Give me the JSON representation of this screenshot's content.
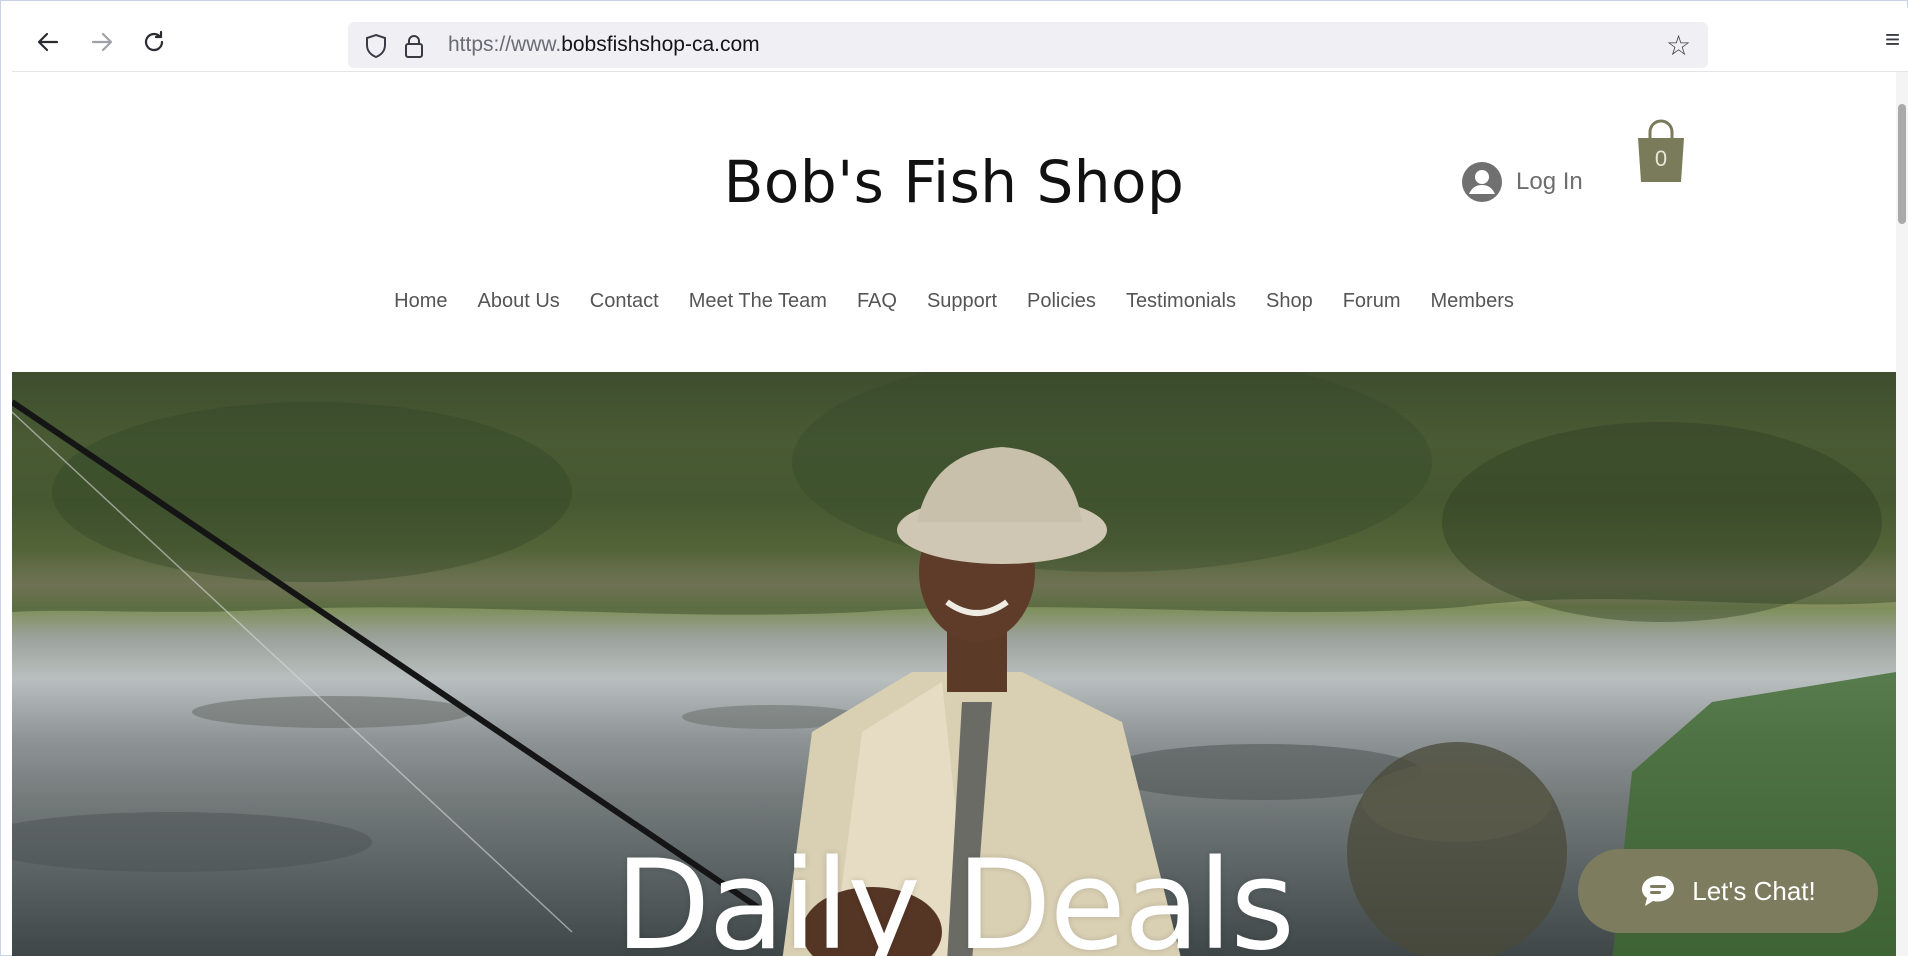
{
  "browser": {
    "url_prefix": "https://www.",
    "url_host": "bobsfishshop-ca.com"
  },
  "site": {
    "title": "Bob's Fish Shop",
    "login_label": "Log In",
    "cart_count": "0",
    "nav": [
      "Home",
      "About Us",
      "Contact",
      "Meet The Team",
      "FAQ",
      "Support",
      "Policies",
      "Testimonials",
      "Shop",
      "Forum",
      "Members"
    ]
  },
  "hero": {
    "title": "Daily Deals"
  },
  "chat": {
    "label": "Let's Chat!"
  },
  "colors": {
    "accent": "#7d7c5f",
    "cart": "#7a7b5a"
  }
}
